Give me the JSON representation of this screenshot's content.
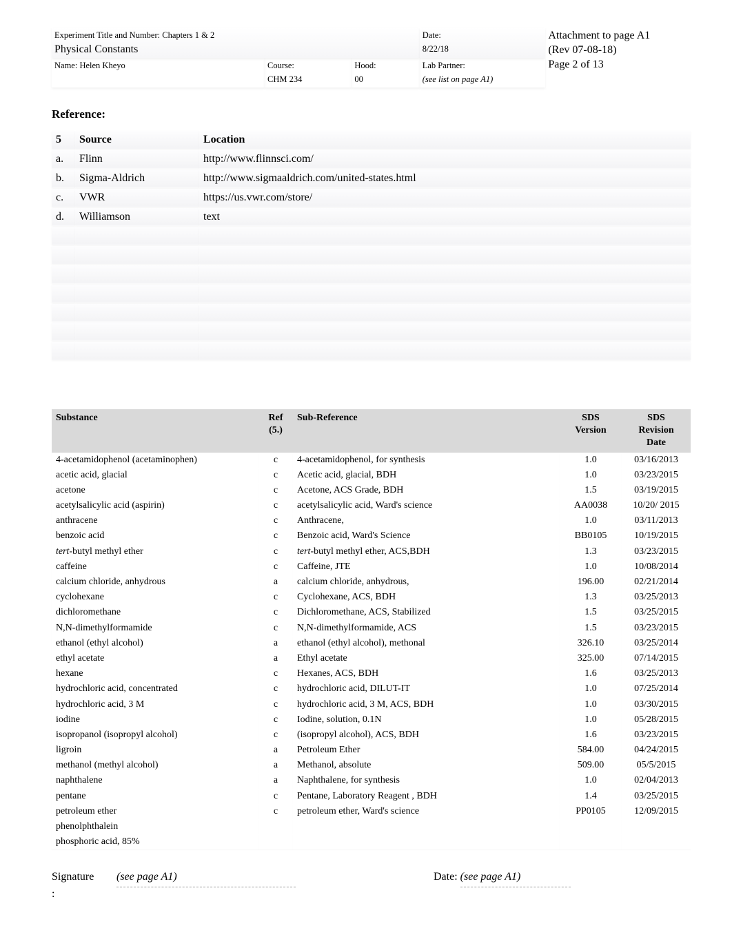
{
  "header": {
    "title_label": "Experiment Title and Number: Chapters 1 & 2",
    "subtitle": "Physical Constants",
    "date_label": "Date:",
    "date_value": "8/22/18",
    "name_label": "Name: Helen Kheyo",
    "course_label": "Course:",
    "course_value": "CHM 234",
    "hood_label": "Hood:",
    "hood_value": "00",
    "partner_label": "Lab Partner:",
    "partner_value": "(see list on page A1)",
    "attachment": "Attachment to page A1",
    "rev": "(Rev 07-08-18)",
    "page": "Page 2 of 13"
  },
  "reference_heading": "Reference:",
  "sources": {
    "num_head": "5",
    "src_head": "Source",
    "loc_head": "Location",
    "rows": [
      {
        "n": "a.",
        "src": "Flinn",
        "loc": "http://www.flinnsci.com/"
      },
      {
        "n": "b.",
        "src": "Sigma-Aldrich",
        "loc": "http://www.sigmaaldrich.com/united-states.html"
      },
      {
        "n": "c.",
        "src": "VWR",
        "loc": "https://us.vwr.com/store/"
      },
      {
        "n": "d.",
        "src": "Williamson",
        "loc": "text"
      }
    ]
  },
  "subs_head": {
    "substance": "Substance",
    "ref": "Ref",
    "ref2": "(5.)",
    "subref": "Sub-Reference",
    "ver": "SDS",
    "ver2": "Version",
    "date": "SDS",
    "date2": "Revision",
    "date3": "Date"
  },
  "substances": [
    {
      "s": "4-acetamidophenol (acetaminophen)",
      "r": "c",
      "sr": "4-acetamidophenol, for synthesis",
      "v": "1.0",
      "d": "03/16/2013"
    },
    {
      "s": "acetic acid, glacial",
      "r": "c",
      "sr": "Acetic acid, glacial, BDH",
      "v": "1.0",
      "d": "03/23/2015"
    },
    {
      "s": "acetone",
      "r": "c",
      "sr": "Acetone, ACS Grade, BDH",
      "v": "1.5",
      "d": "03/19/2015"
    },
    {
      "s": "acetylsalicylic acid (aspirin)",
      "r": "c",
      "sr": "acetylsalicylic acid, Ward's science",
      "v": "AA0038",
      "d": "10/20/ 2015"
    },
    {
      "s": "anthracene",
      "r": "c",
      "sr": "Anthracene,",
      "v": "1.0",
      "d": "03/11/2013"
    },
    {
      "s": "benzoic acid",
      "r": "c",
      "sr": "Benzoic acid, Ward's Science",
      "v": "BB0105",
      "d": "10/19/2015"
    },
    {
      "s": "tert-butyl methyl ether",
      "it": true,
      "r": "c",
      "sr": "tert-butyl methyl ether, ACS,BDH",
      "sr_it": true,
      "v": "1.3",
      "d": "03/23/2015"
    },
    {
      "s": "caffeine",
      "r": "c",
      "sr": "Caffeine, JTE",
      "v": "1.0",
      "d": "10/08/2014"
    },
    {
      "s": "calcium chloride, anhydrous",
      "r": "a",
      "sr": "calcium chloride, anhydrous,",
      "v": "196.00",
      "d": "02/21/2014"
    },
    {
      "s": "cyclohexane",
      "r": "c",
      "sr": "Cyclohexane, ACS, BDH",
      "v": "1.3",
      "d": "03/25/2013"
    },
    {
      "s": "dichloromethane",
      "r": "c",
      "sr": "Dichloromethane, ACS, Stabilized",
      "v": "1.5",
      "d": "03/25/2015"
    },
    {
      "s": "N,N-dimethylformamide",
      "r": "c",
      "sr": "N,N-dimethylformamide, ACS",
      "v": "1.5",
      "d": "03/23/2015"
    },
    {
      "s": "ethanol (ethyl alcohol)",
      "r": "a",
      "sr": "ethanol (ethyl alcohol), methonal",
      "v": "326.10",
      "d": "03/25/2014"
    },
    {
      "s": "ethyl acetate",
      "r": "a",
      "sr": "Ethyl acetate",
      "v": "325.00",
      "d": "07/14/2015"
    },
    {
      "s": "hexane",
      "r": "c",
      "sr": "Hexanes, ACS, BDH",
      "v": "1.6",
      "d": "03/25/2013"
    },
    {
      "s": "hydrochloric acid, concentrated",
      "r": "c",
      "sr": "hydrochloric acid, DILUT-IT",
      "v": "1.0",
      "d": "07/25/2014"
    },
    {
      "s": "hydrochloric acid, 3 M",
      "r": "c",
      "sr": "hydrochloric acid, 3 M, ACS, BDH",
      "v": "1.0",
      "d": "03/30/2015"
    },
    {
      "s": "iodine",
      "r": "c",
      "sr": "Iodine, solution, 0.1N",
      "v": "1.0",
      "d": "05/28/2015"
    },
    {
      "s": "isopropanol (isopropyl alcohol)",
      "r": "c",
      "sr": " (isopropyl alcohol), ACS, BDH",
      "v": "1.6",
      "d": "03/23/2015"
    },
    {
      "s": "ligroin",
      "r": "a",
      "sr": "Petroleum Ether",
      "v": "584.00",
      "d": "04/24/2015"
    },
    {
      "s": "methanol (methyl alcohol)",
      "r": "a",
      "sr": "Methanol, absolute",
      "v": "509.00",
      "d": "05/5/2015"
    },
    {
      "s": "naphthalene",
      "r": "a",
      "sr": "Naphthalene, for synthesis",
      "v": "1.0",
      "d": "02/04/2013"
    },
    {
      "s": "pentane",
      "r": "c",
      "sr": "Pentane, Laboratory Reagent , BDH",
      "v": "1.4",
      "d": "03/25/2015"
    },
    {
      "s": "petroleum ether",
      "r": "c",
      "sr": "petroleum ether, Ward's science",
      "v": "PP0105",
      "d": "12/09/2015"
    },
    {
      "s": "phenolphthalein",
      "r": "",
      "sr": "",
      "v": "",
      "d": ""
    },
    {
      "s": "phosphoric acid, 85%",
      "r": "",
      "sr": "",
      "v": "",
      "d": ""
    }
  ],
  "footer": {
    "sig_label": "Signature",
    "colon": ":",
    "sig_value": "(see page A1)",
    "date_label": "Date:",
    "date_value": "(see page A1)"
  }
}
